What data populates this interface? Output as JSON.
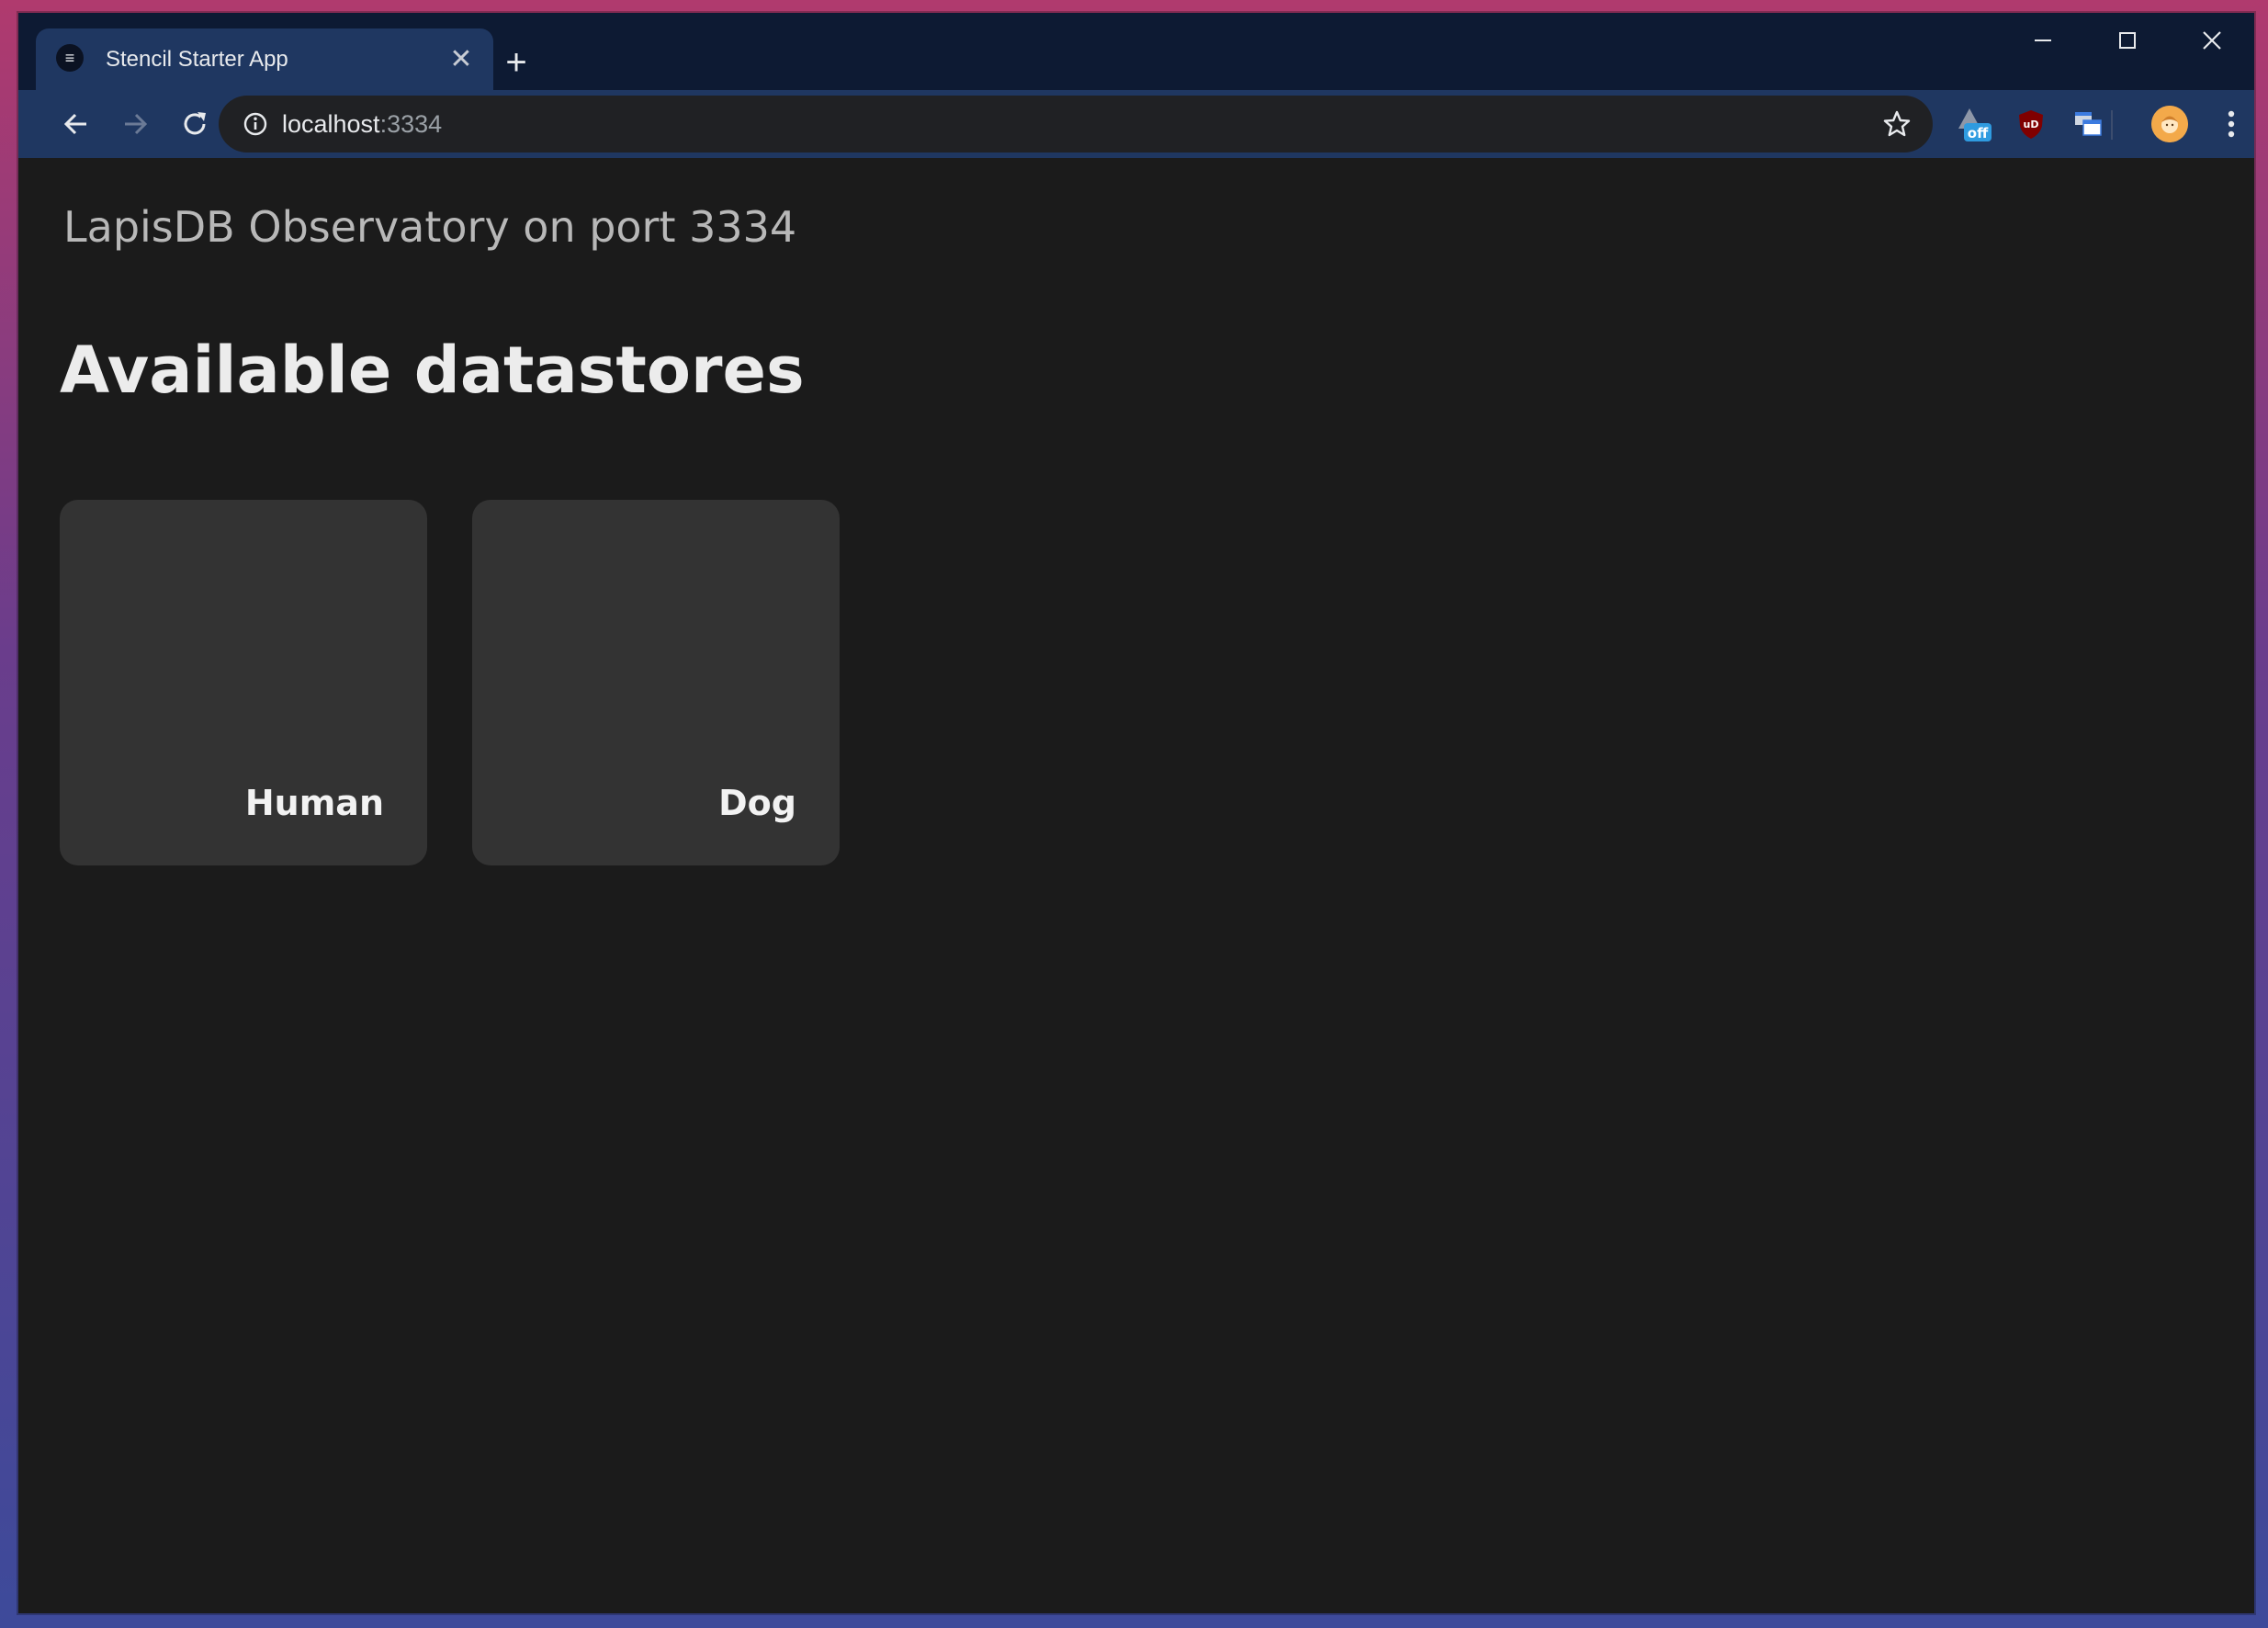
{
  "browser": {
    "tab": {
      "title": "Stencil Starter App",
      "favicon_glyph": "≡",
      "close_glyph": "✕"
    },
    "new_tab_glyph": "+",
    "address": {
      "host": "localhost",
      "port": ":3334"
    },
    "extensions": [
      {
        "name": "dark-reader-extension",
        "badge": "off"
      },
      {
        "name": "ublock-origin-extension",
        "badge": "uD"
      },
      {
        "name": "window-resizer-extension"
      }
    ]
  },
  "page": {
    "app_title": "LapisDB Observatory on port 3334",
    "section_heading": "Available datastores",
    "datastores": [
      {
        "label": "Human"
      },
      {
        "label": "Dog"
      }
    ]
  },
  "colors": {
    "titlebar": "#0d1a33",
    "toolbar": "#1f3761",
    "page_background": "#1b1b1b",
    "card_background": "#333333"
  }
}
